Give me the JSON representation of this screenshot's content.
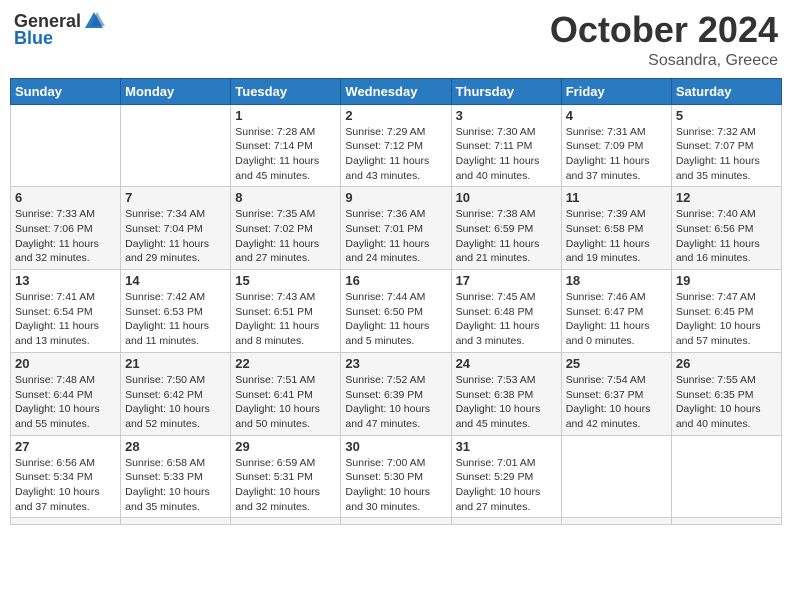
{
  "header": {
    "logo_general": "General",
    "logo_blue": "Blue",
    "month": "October 2024",
    "location": "Sosandra, Greece"
  },
  "weekdays": [
    "Sunday",
    "Monday",
    "Tuesday",
    "Wednesday",
    "Thursday",
    "Friday",
    "Saturday"
  ],
  "days": [
    {
      "num": "",
      "sunrise": "",
      "sunset": "",
      "daylight": ""
    },
    {
      "num": "",
      "sunrise": "",
      "sunset": "",
      "daylight": ""
    },
    {
      "num": "1",
      "sunrise": "Sunrise: 7:28 AM",
      "sunset": "Sunset: 7:14 PM",
      "daylight": "Daylight: 11 hours and 45 minutes."
    },
    {
      "num": "2",
      "sunrise": "Sunrise: 7:29 AM",
      "sunset": "Sunset: 7:12 PM",
      "daylight": "Daylight: 11 hours and 43 minutes."
    },
    {
      "num": "3",
      "sunrise": "Sunrise: 7:30 AM",
      "sunset": "Sunset: 7:11 PM",
      "daylight": "Daylight: 11 hours and 40 minutes."
    },
    {
      "num": "4",
      "sunrise": "Sunrise: 7:31 AM",
      "sunset": "Sunset: 7:09 PM",
      "daylight": "Daylight: 11 hours and 37 minutes."
    },
    {
      "num": "5",
      "sunrise": "Sunrise: 7:32 AM",
      "sunset": "Sunset: 7:07 PM",
      "daylight": "Daylight: 11 hours and 35 minutes."
    },
    {
      "num": "6",
      "sunrise": "Sunrise: 7:33 AM",
      "sunset": "Sunset: 7:06 PM",
      "daylight": "Daylight: 11 hours and 32 minutes."
    },
    {
      "num": "7",
      "sunrise": "Sunrise: 7:34 AM",
      "sunset": "Sunset: 7:04 PM",
      "daylight": "Daylight: 11 hours and 29 minutes."
    },
    {
      "num": "8",
      "sunrise": "Sunrise: 7:35 AM",
      "sunset": "Sunset: 7:02 PM",
      "daylight": "Daylight: 11 hours and 27 minutes."
    },
    {
      "num": "9",
      "sunrise": "Sunrise: 7:36 AM",
      "sunset": "Sunset: 7:01 PM",
      "daylight": "Daylight: 11 hours and 24 minutes."
    },
    {
      "num": "10",
      "sunrise": "Sunrise: 7:38 AM",
      "sunset": "Sunset: 6:59 PM",
      "daylight": "Daylight: 11 hours and 21 minutes."
    },
    {
      "num": "11",
      "sunrise": "Sunrise: 7:39 AM",
      "sunset": "Sunset: 6:58 PM",
      "daylight": "Daylight: 11 hours and 19 minutes."
    },
    {
      "num": "12",
      "sunrise": "Sunrise: 7:40 AM",
      "sunset": "Sunset: 6:56 PM",
      "daylight": "Daylight: 11 hours and 16 minutes."
    },
    {
      "num": "13",
      "sunrise": "Sunrise: 7:41 AM",
      "sunset": "Sunset: 6:54 PM",
      "daylight": "Daylight: 11 hours and 13 minutes."
    },
    {
      "num": "14",
      "sunrise": "Sunrise: 7:42 AM",
      "sunset": "Sunset: 6:53 PM",
      "daylight": "Daylight: 11 hours and 11 minutes."
    },
    {
      "num": "15",
      "sunrise": "Sunrise: 7:43 AM",
      "sunset": "Sunset: 6:51 PM",
      "daylight": "Daylight: 11 hours and 8 minutes."
    },
    {
      "num": "16",
      "sunrise": "Sunrise: 7:44 AM",
      "sunset": "Sunset: 6:50 PM",
      "daylight": "Daylight: 11 hours and 5 minutes."
    },
    {
      "num": "17",
      "sunrise": "Sunrise: 7:45 AM",
      "sunset": "Sunset: 6:48 PM",
      "daylight": "Daylight: 11 hours and 3 minutes."
    },
    {
      "num": "18",
      "sunrise": "Sunrise: 7:46 AM",
      "sunset": "Sunset: 6:47 PM",
      "daylight": "Daylight: 11 hours and 0 minutes."
    },
    {
      "num": "19",
      "sunrise": "Sunrise: 7:47 AM",
      "sunset": "Sunset: 6:45 PM",
      "daylight": "Daylight: 10 hours and 57 minutes."
    },
    {
      "num": "20",
      "sunrise": "Sunrise: 7:48 AM",
      "sunset": "Sunset: 6:44 PM",
      "daylight": "Daylight: 10 hours and 55 minutes."
    },
    {
      "num": "21",
      "sunrise": "Sunrise: 7:50 AM",
      "sunset": "Sunset: 6:42 PM",
      "daylight": "Daylight: 10 hours and 52 minutes."
    },
    {
      "num": "22",
      "sunrise": "Sunrise: 7:51 AM",
      "sunset": "Sunset: 6:41 PM",
      "daylight": "Daylight: 10 hours and 50 minutes."
    },
    {
      "num": "23",
      "sunrise": "Sunrise: 7:52 AM",
      "sunset": "Sunset: 6:39 PM",
      "daylight": "Daylight: 10 hours and 47 minutes."
    },
    {
      "num": "24",
      "sunrise": "Sunrise: 7:53 AM",
      "sunset": "Sunset: 6:38 PM",
      "daylight": "Daylight: 10 hours and 45 minutes."
    },
    {
      "num": "25",
      "sunrise": "Sunrise: 7:54 AM",
      "sunset": "Sunset: 6:37 PM",
      "daylight": "Daylight: 10 hours and 42 minutes."
    },
    {
      "num": "26",
      "sunrise": "Sunrise: 7:55 AM",
      "sunset": "Sunset: 6:35 PM",
      "daylight": "Daylight: 10 hours and 40 minutes."
    },
    {
      "num": "27",
      "sunrise": "Sunrise: 6:56 AM",
      "sunset": "Sunset: 5:34 PM",
      "daylight": "Daylight: 10 hours and 37 minutes."
    },
    {
      "num": "28",
      "sunrise": "Sunrise: 6:58 AM",
      "sunset": "Sunset: 5:33 PM",
      "daylight": "Daylight: 10 hours and 35 minutes."
    },
    {
      "num": "29",
      "sunrise": "Sunrise: 6:59 AM",
      "sunset": "Sunset: 5:31 PM",
      "daylight": "Daylight: 10 hours and 32 minutes."
    },
    {
      "num": "30",
      "sunrise": "Sunrise: 7:00 AM",
      "sunset": "Sunset: 5:30 PM",
      "daylight": "Daylight: 10 hours and 30 minutes."
    },
    {
      "num": "31",
      "sunrise": "Sunrise: 7:01 AM",
      "sunset": "Sunset: 5:29 PM",
      "daylight": "Daylight: 10 hours and 27 minutes."
    },
    {
      "num": "",
      "sunrise": "",
      "sunset": "",
      "daylight": ""
    },
    {
      "num": "",
      "sunrise": "",
      "sunset": "",
      "daylight": ""
    }
  ]
}
